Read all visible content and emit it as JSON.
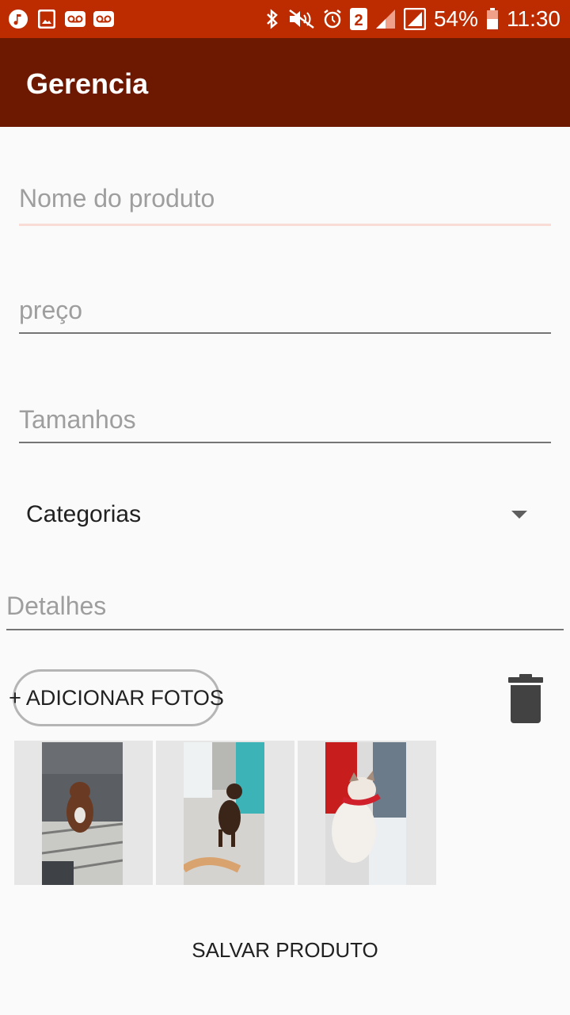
{
  "status_bar": {
    "battery": "54%",
    "time": "11:30",
    "sim": "2",
    "icons": [
      "music-icon",
      "image-icon",
      "voicemail-icon",
      "voicemail-icon",
      "bluetooth-icon",
      "mute-icon",
      "alarm-icon",
      "sim-icon",
      "signal-icon",
      "signal-icon",
      "battery-icon"
    ]
  },
  "app_bar": {
    "title": "Gerencia"
  },
  "form": {
    "name_placeholder": "Nome do produto",
    "price_placeholder": "preço",
    "sizes_placeholder": "Tamanhos",
    "categories_label": "Categorias",
    "details_placeholder": "Detalhes"
  },
  "actions": {
    "add_photos": "+ ADICIONAR FOTOS",
    "save": "SALVAR PRODUTO"
  },
  "photos": [
    {
      "alt_icon": "dog-photo"
    },
    {
      "alt_icon": "dog-photo"
    },
    {
      "alt_icon": "cat-photo"
    }
  ],
  "colors": {
    "status_bar": "#bd2c00",
    "app_bar": "#6d1800",
    "background": "#fafafa"
  }
}
